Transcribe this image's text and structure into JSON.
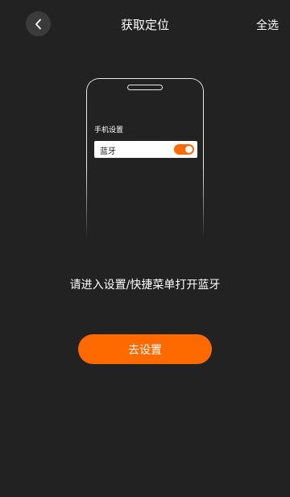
{
  "header": {
    "back_icon": "chevron-left-icon",
    "title": "获取定位",
    "select_all_label": "全选"
  },
  "phone": {
    "settings_title": "手机设置",
    "bluetooth_label": "蓝牙",
    "bluetooth_on": true
  },
  "instruction": "请进入设置/快捷菜单打开蓝牙",
  "action": {
    "button_label": "去设置"
  },
  "colors": {
    "background": "#222222",
    "accent": "#ff6a00",
    "back_button_bg": "#3b3b3b",
    "phone_outline": "#e9e9e9"
  }
}
